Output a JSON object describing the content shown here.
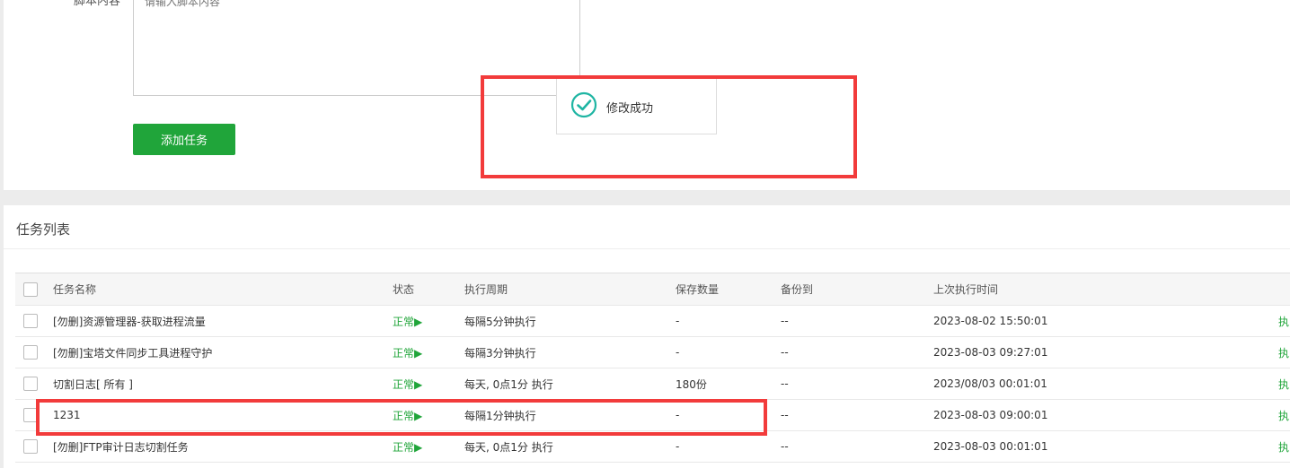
{
  "form": {
    "script_label": "脚本内容",
    "script_placeholder": "请输入脚本内容",
    "add_task_label": "添加任务"
  },
  "toast": {
    "message": "修改成功"
  },
  "task_list": {
    "title": "任务列表",
    "columns": [
      "任务名称",
      "状态",
      "执行周期",
      "保存数量",
      "备份到",
      "上次执行时间"
    ],
    "rows": [
      {
        "name": "[勿删]资源管理器-获取进程流量",
        "status": "正常▶",
        "cycle": "每隔5分钟执行",
        "keep": "-",
        "backup": "--",
        "last_run": "2023-08-02 15:50:01",
        "op": "执"
      },
      {
        "name": "[勿删]宝塔文件同步工具进程守护",
        "status": "正常▶",
        "cycle": "每隔3分钟执行",
        "keep": "-",
        "backup": "--",
        "last_run": "2023-08-03 09:27:01",
        "op": "执"
      },
      {
        "name": "切割日志[ 所有 ]",
        "status": "正常▶",
        "cycle": "每天, 0点1分 执行",
        "keep": "180份",
        "backup": "--",
        "last_run": "2023/08/03 00:01:01",
        "op": "执"
      },
      {
        "name": "1231",
        "status": "正常▶",
        "cycle": "每隔1分钟执行",
        "keep": "-",
        "backup": "--",
        "last_run": "2023-08-03 09:00:01",
        "op": "执"
      },
      {
        "name": "[勿删]FTP审计日志切割任务",
        "status": "正常▶",
        "cycle": "每天, 0点1分 执行",
        "keep": "-",
        "backup": "--",
        "last_run": "2023-08-03 00:01:01",
        "op": "执"
      }
    ]
  },
  "colors": {
    "accent_green": "#20a53a",
    "highlight_red": "#f23b3b"
  }
}
